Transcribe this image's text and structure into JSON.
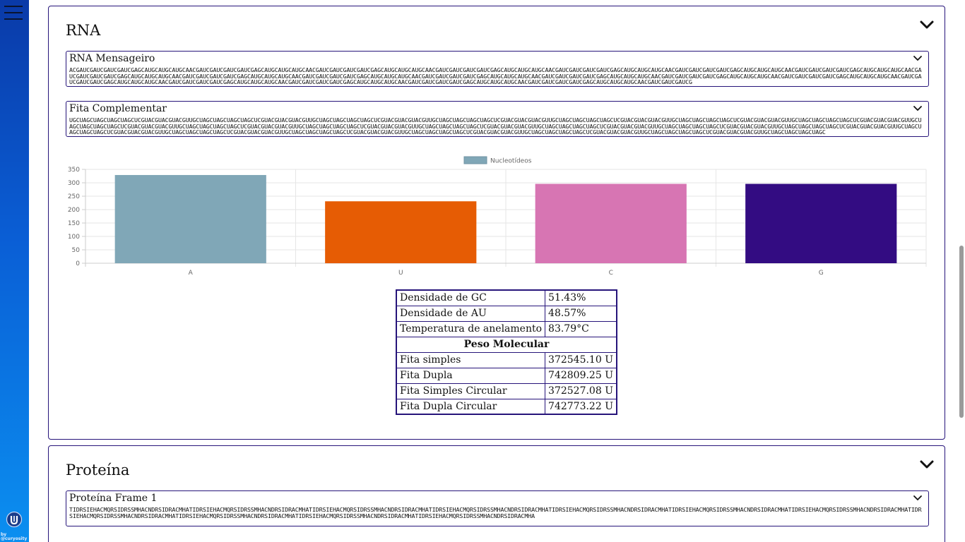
{
  "sidebar": {
    "logo_icon": "curyosity-logo",
    "by_line": "by",
    "brand": "@curyosity"
  },
  "rna": {
    "title": "RNA",
    "mensageiro": {
      "label": "RNA Mensageiro",
      "sequence": "ACGAUCGAUCGAUCGAUCGAGCAUGCAUGCAUGCAACGAUCGAUCGAUCGAUCGAGCAUGCAUGCAUGCAACGAUCGAUCGAUCGAUCGAGCAUGCAUGCAUGCAACGAUCGAUCGAUCGAUCGAGCAUGCAUGCAUGCAACGAUCGAUCGAUCGAUCGAGCAUGCAUGCAUGCAACGAUCGAUCGAUCGAUCGAGCAUGCAUGCAUGCAACGAUCGAUCGAUCGAUCGAGCAUGCAUGCAUGCAACGAUCGAUCGAUCGAUCGAGCAUGCAUGCAUGCAACGAUCGAUCGAUCGAUCGAGCAUGCAUGCAUGCAACGAUCGAUCGAUCGAUCGAGCAUGCAUGCAUGCAACGAUCGAUCGAUCGAUCGAGCAUGCAUGCAUGCAACGAUCGAUCGAUCGAUCGAGCAUGCAUGCAUGCAACGAUCGAUCGAUCGAUCGAGCAUGCAUGCAUGCAACGAUCGAUCGAUCGAUCGAGCAUGCAUGCAUGCAACGAUCGAUCGAUCGAUCGAGCAUGCAUGCAUGCAACGAUCGAUCGAUCGAUCGAGCAUGCAUGCAUGCAACGAUCGAUCGAUCGAUCGAGCAUGCAUGCAUGCAACGAUCGAUCGAUCGAUCGAGCAUGCAUGCAUGCAACGAUCGAUCGAUCGAUCGAGCAUGCAUGCAUGCAACGAUCGAUCGAUCG"
    },
    "complementar": {
      "label": "Fita Complementar",
      "sequence": "UGCUAGCUAGCUAGCUAGCUCGUACGUACGUACGUUGCUAGCUAGCUAGCUAGCUCGUACGUACGUACGUUGCUAGCUAGCUAGCUAGCUCGUACGUACGUACGUUGCUAGCUAGCUAGCUAGCUCGUACGUACGUACGUUGCUAGCUAGCUAGCUAGCUCGUACGUACGUACGUUGCUAGCUAGCUAGCUAGCUCGUACGUACGUACGUUGCUAGCUAGCUAGCUAGCUCGUACGUACGUACGUUGCUAGCUAGCUAGCUAGCUCGUACGUACGUACGUUGCUAGCUAGCUAGCUAGCUCGUACGUACGUACGUUGCUAGCUAGCUAGCUAGCUCGUACGUACGUACGUUGCUAGCUAGCUAGCUAGCUCGUACGUACGUACGUUGCUAGCUAGCUAGCUAGCUCGUACGUACGUACGUUGCUAGCUAGCUAGCUAGCUCGUACGUACGUACGUUGCUAGCUAGCUAGCUAGCUCGUACGUACGUACGUUGCUAGCUAGCUAGCUAGCUCGUACGUACGUACGUUGCUAGCUAGCUAGCUAGCUCGUACGUACGUACGUUGCUAGCUAGCUAGCUAGCUCGUACGUACGUACGUUGCUAGCUAGCUAGCUAGCUCGUACGUACGUACGUUGCUAGCUAGCUAGCUAGCUCGUACGUACGUACGUUGCUAGCUAGCUAGCUAGCUCGUACGUACGUACGUUGCUAGCUAGCUAGCUAGC"
    },
    "table": {
      "gc_label": "Densidade de GC",
      "gc_value": "51.43%",
      "au_label": "Densidade de AU",
      "au_value": "48.57%",
      "temp_label": "Temperatura de anelamento",
      "temp_value": "83.79°C",
      "peso_header": "Peso Molecular",
      "simples_label": "Fita simples",
      "simples_value": "372545.10 U",
      "dupla_label": "Fita Dupla",
      "dupla_value": "742809.25 U",
      "simples_circ_label": "Fita Simples Circular",
      "simples_circ_value": "372527.08 U",
      "dupla_circ_label": "Fita Dupla Circular",
      "dupla_circ_value": "742773.22 U"
    }
  },
  "proteina": {
    "title": "Proteína",
    "frame1": {
      "label": "Proteína Frame 1",
      "sequence": "TIDRSIEHACMQRSIDRSSMHACNDRSIDRACMHATIDRSIEHACMQRSIDRSSMHACNDRSIDRACMHATIDRSIEHACMQRSIDRSSMHACNDRSIDRACMHATIDRSIEHACMQRSIDRSSMHACNDRSIDRACMHATIDRSIEHACMQRSIDRSSMHACNDRSIDRACMHATIDRSIEHACMQRSIDRSSMHACNDRSIDRACMHATIDRSIEHACMQRSIDRSSMHACNDRSIDRACMHATIDRSIEHACMQRSIDRSSMHACNDRSIDRACMHATIDRSIEHACMQRSIDRSSMHACNDRSIDRACMHATIDRSIEHACMQRSIDRSSMHACNDRSIDRACMHATIDRSIEHACMQRSIDRSSMHACNDRSIDRACMHA"
    }
  },
  "chart_data": {
    "type": "bar",
    "legend_position": "top",
    "grid": true,
    "categories": [
      "A",
      "U",
      "C",
      "G"
    ],
    "series": [
      {
        "name": "Nucleotídeos",
        "values": [
          329,
          231,
          296,
          296
        ]
      }
    ],
    "colors": [
      "#80a7b7",
      "#e65c04",
      "#d775b3",
      "#330c82"
    ],
    "legend_color": "#80a7b7",
    "yticks": [
      0,
      50,
      100,
      150,
      200,
      250,
      300,
      350
    ],
    "ylim": [
      0,
      350
    ]
  }
}
